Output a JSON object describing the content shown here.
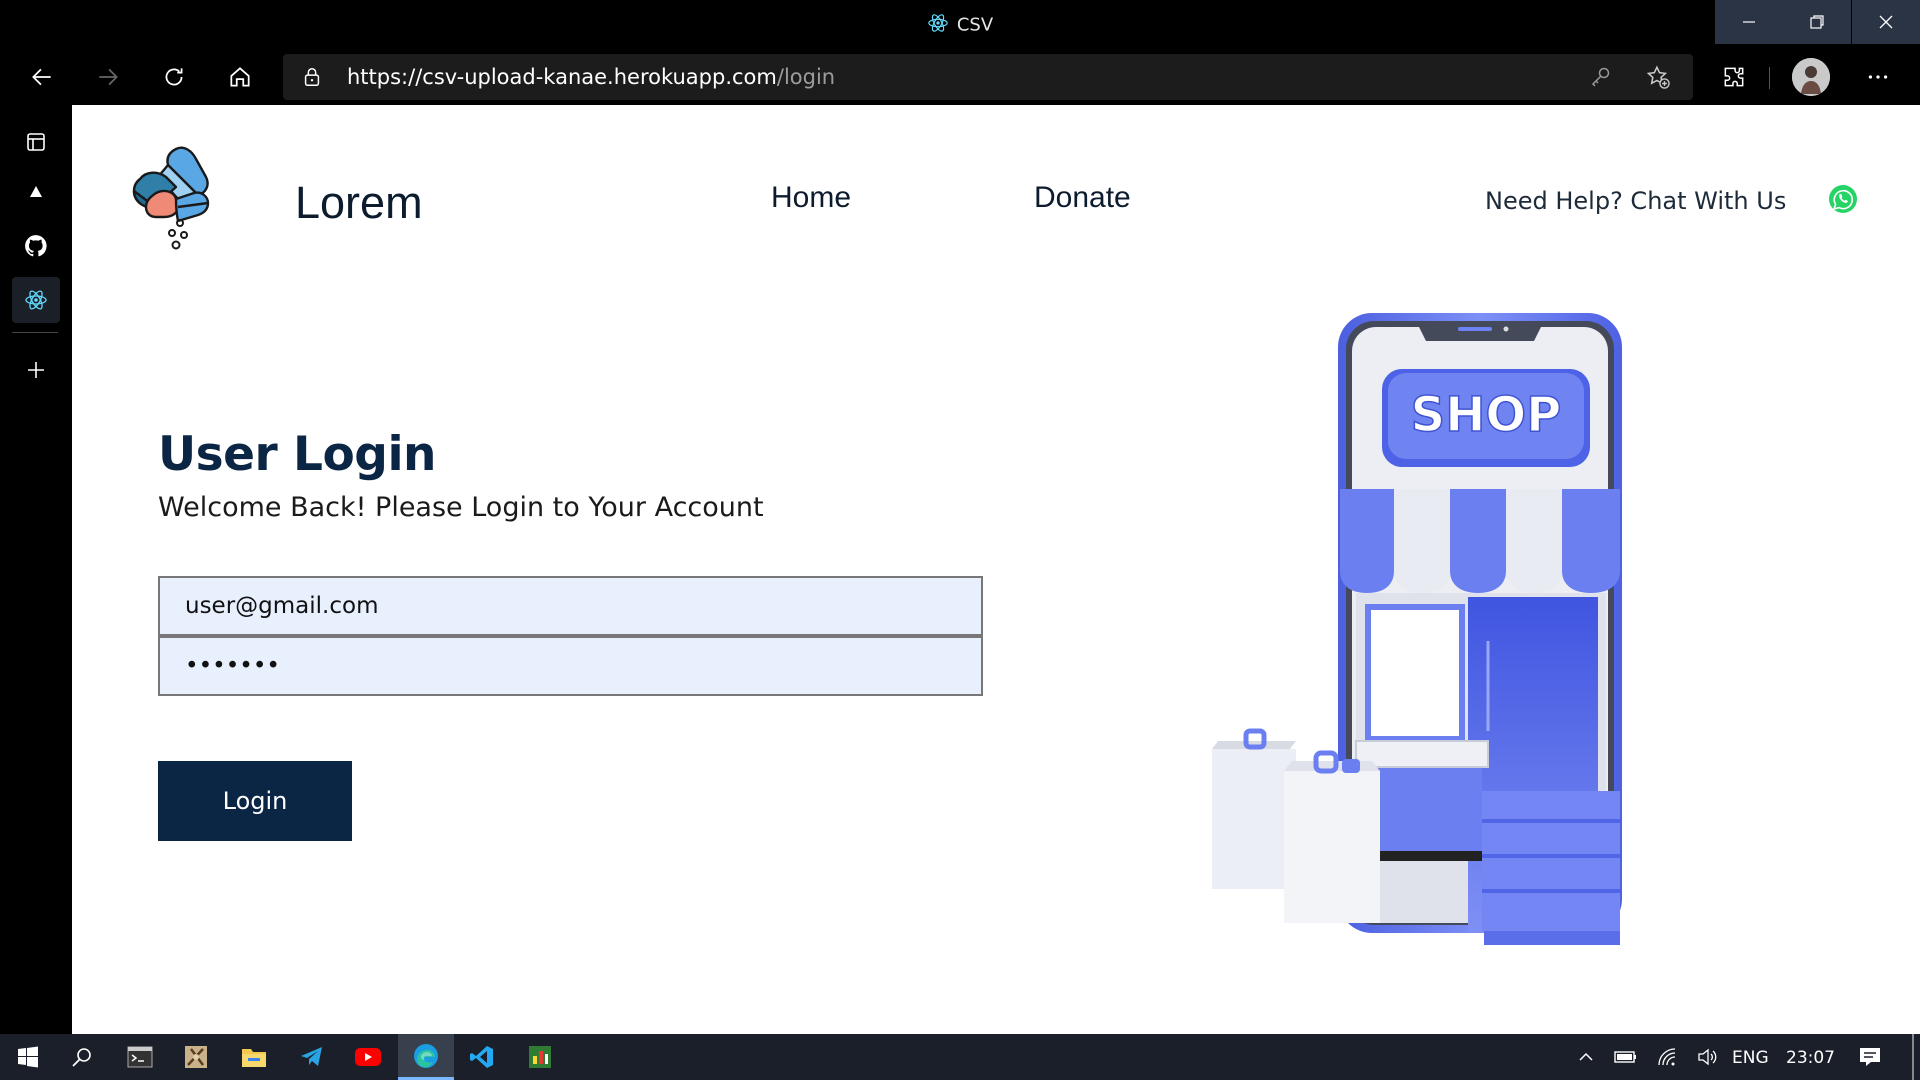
{
  "window": {
    "title": "CSV"
  },
  "address": {
    "url_host": "https://csv-upload-kanae.herokuapp.com",
    "url_path": "/login"
  },
  "site": {
    "brand": "Lorem",
    "nav": {
      "home": "Home",
      "donate": "Donate"
    },
    "help": "Need Help? Chat With Us"
  },
  "login": {
    "heading": "User Login",
    "subtitle": "Welcome Back! Please Login to Your Account",
    "email_value": "user@gmail.com",
    "password_value": "1234567",
    "button": "Login"
  },
  "illustration": {
    "sign": "SHOP"
  },
  "taskbar": {
    "lang": "ENG",
    "time": "23:07"
  },
  "colors": {
    "primary": "#0b2545",
    "input_bg": "#e8f0fe",
    "shop_blue": "#6b7ff0",
    "whatsapp": "#25d366"
  }
}
